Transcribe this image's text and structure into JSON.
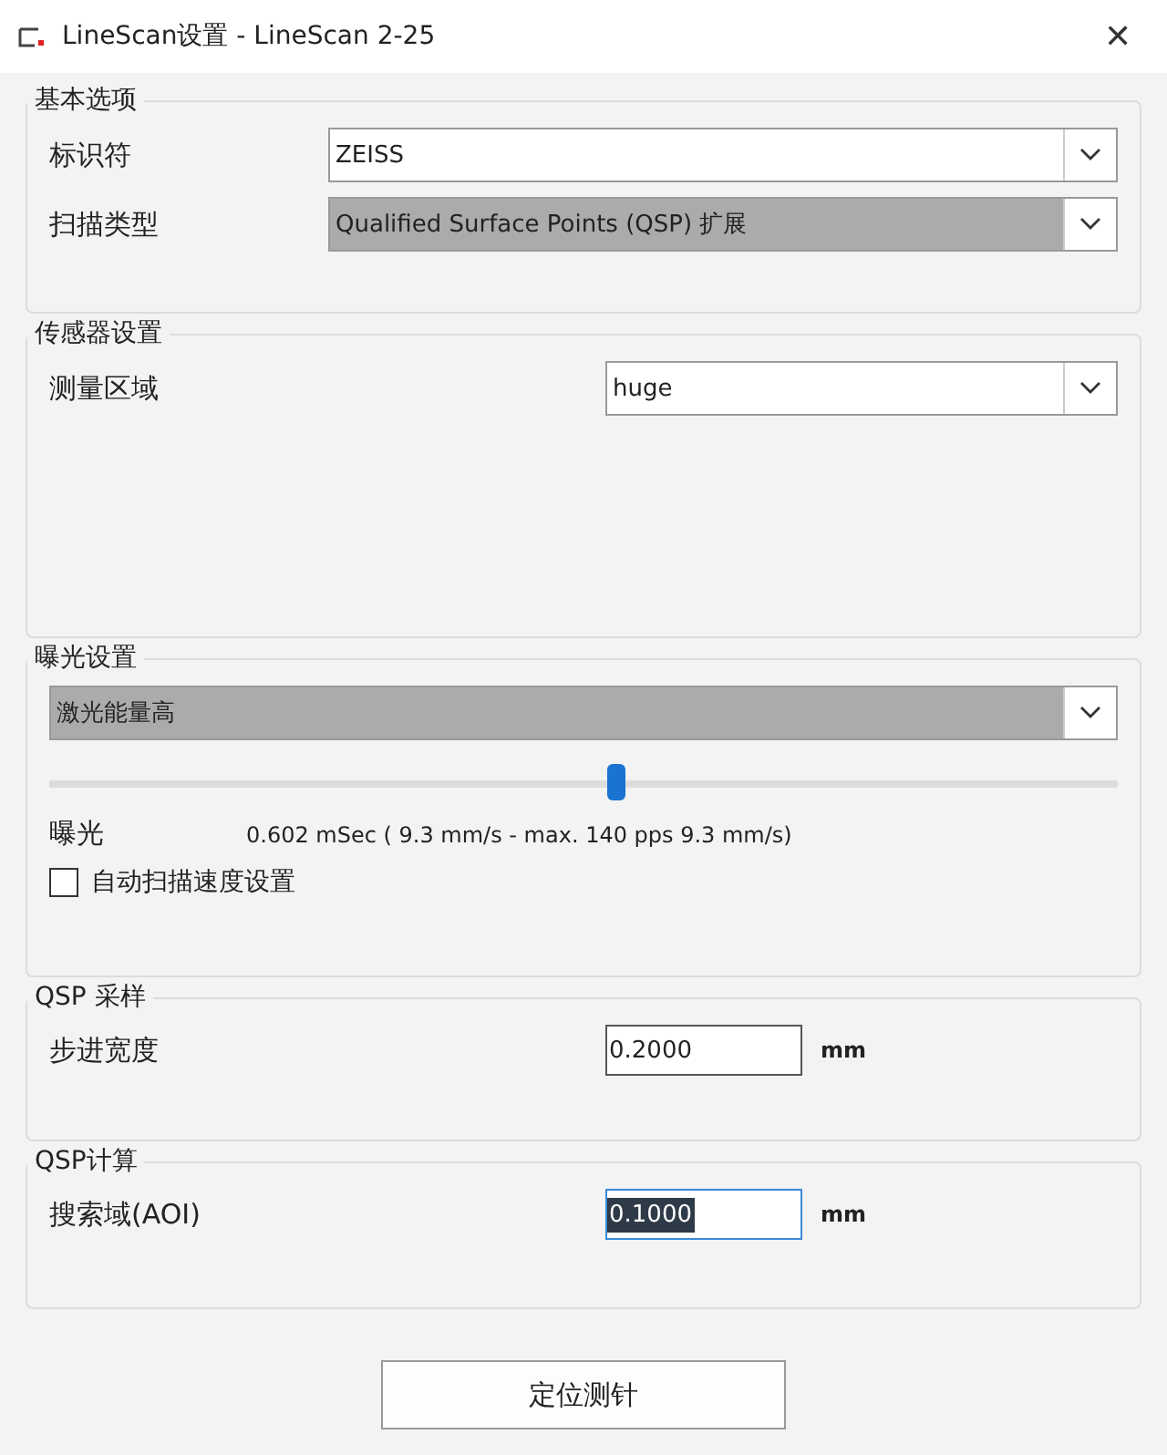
{
  "window": {
    "title": "LineScan设置 - LineScan 2-25",
    "close": "✕"
  },
  "groups": [
    {
      "title": "基本选项",
      "items": [
        {
          "kind": "dropdown",
          "label": "标识符",
          "value": "ZEISS",
          "highlighted": false
        },
        {
          "kind": "dropdown",
          "label": "扫描类型",
          "value": "Qualified Surface Points (QSP) 扩展",
          "highlighted": true
        }
      ]
    },
    {
      "title": "传感器设置",
      "items": [
        {
          "kind": "dropdown",
          "label": "测量区域",
          "value": "huge",
          "highlighted": false
        }
      ]
    },
    {
      "title": "曝光设置",
      "items": [
        {
          "kind": "dropdown",
          "value": "激光能量高",
          "highlighted": true
        },
        {
          "kind": "slider",
          "level": 0.53
        },
        {
          "kind": "reading",
          "label": "曝光",
          "value": "0.602 mSec ( 9.3 mm/s - max. 140 pps 9.3 mm/s)"
        },
        {
          "kind": "checkbox",
          "label": "自动扫描速度设置",
          "checked": false
        }
      ]
    },
    {
      "title": "QSP 采样",
      "items": [
        {
          "kind": "input",
          "label": "步进宽度",
          "value": "0.2000",
          "unit": "mm",
          "text_selected": false
        }
      ]
    },
    {
      "title": "QSP计算",
      "items": [
        {
          "kind": "input",
          "label": "搜索域(AOI)",
          "value": "0.1000",
          "unit": "mm",
          "text_selected": true
        }
      ]
    }
  ],
  "button": "定位测针"
}
